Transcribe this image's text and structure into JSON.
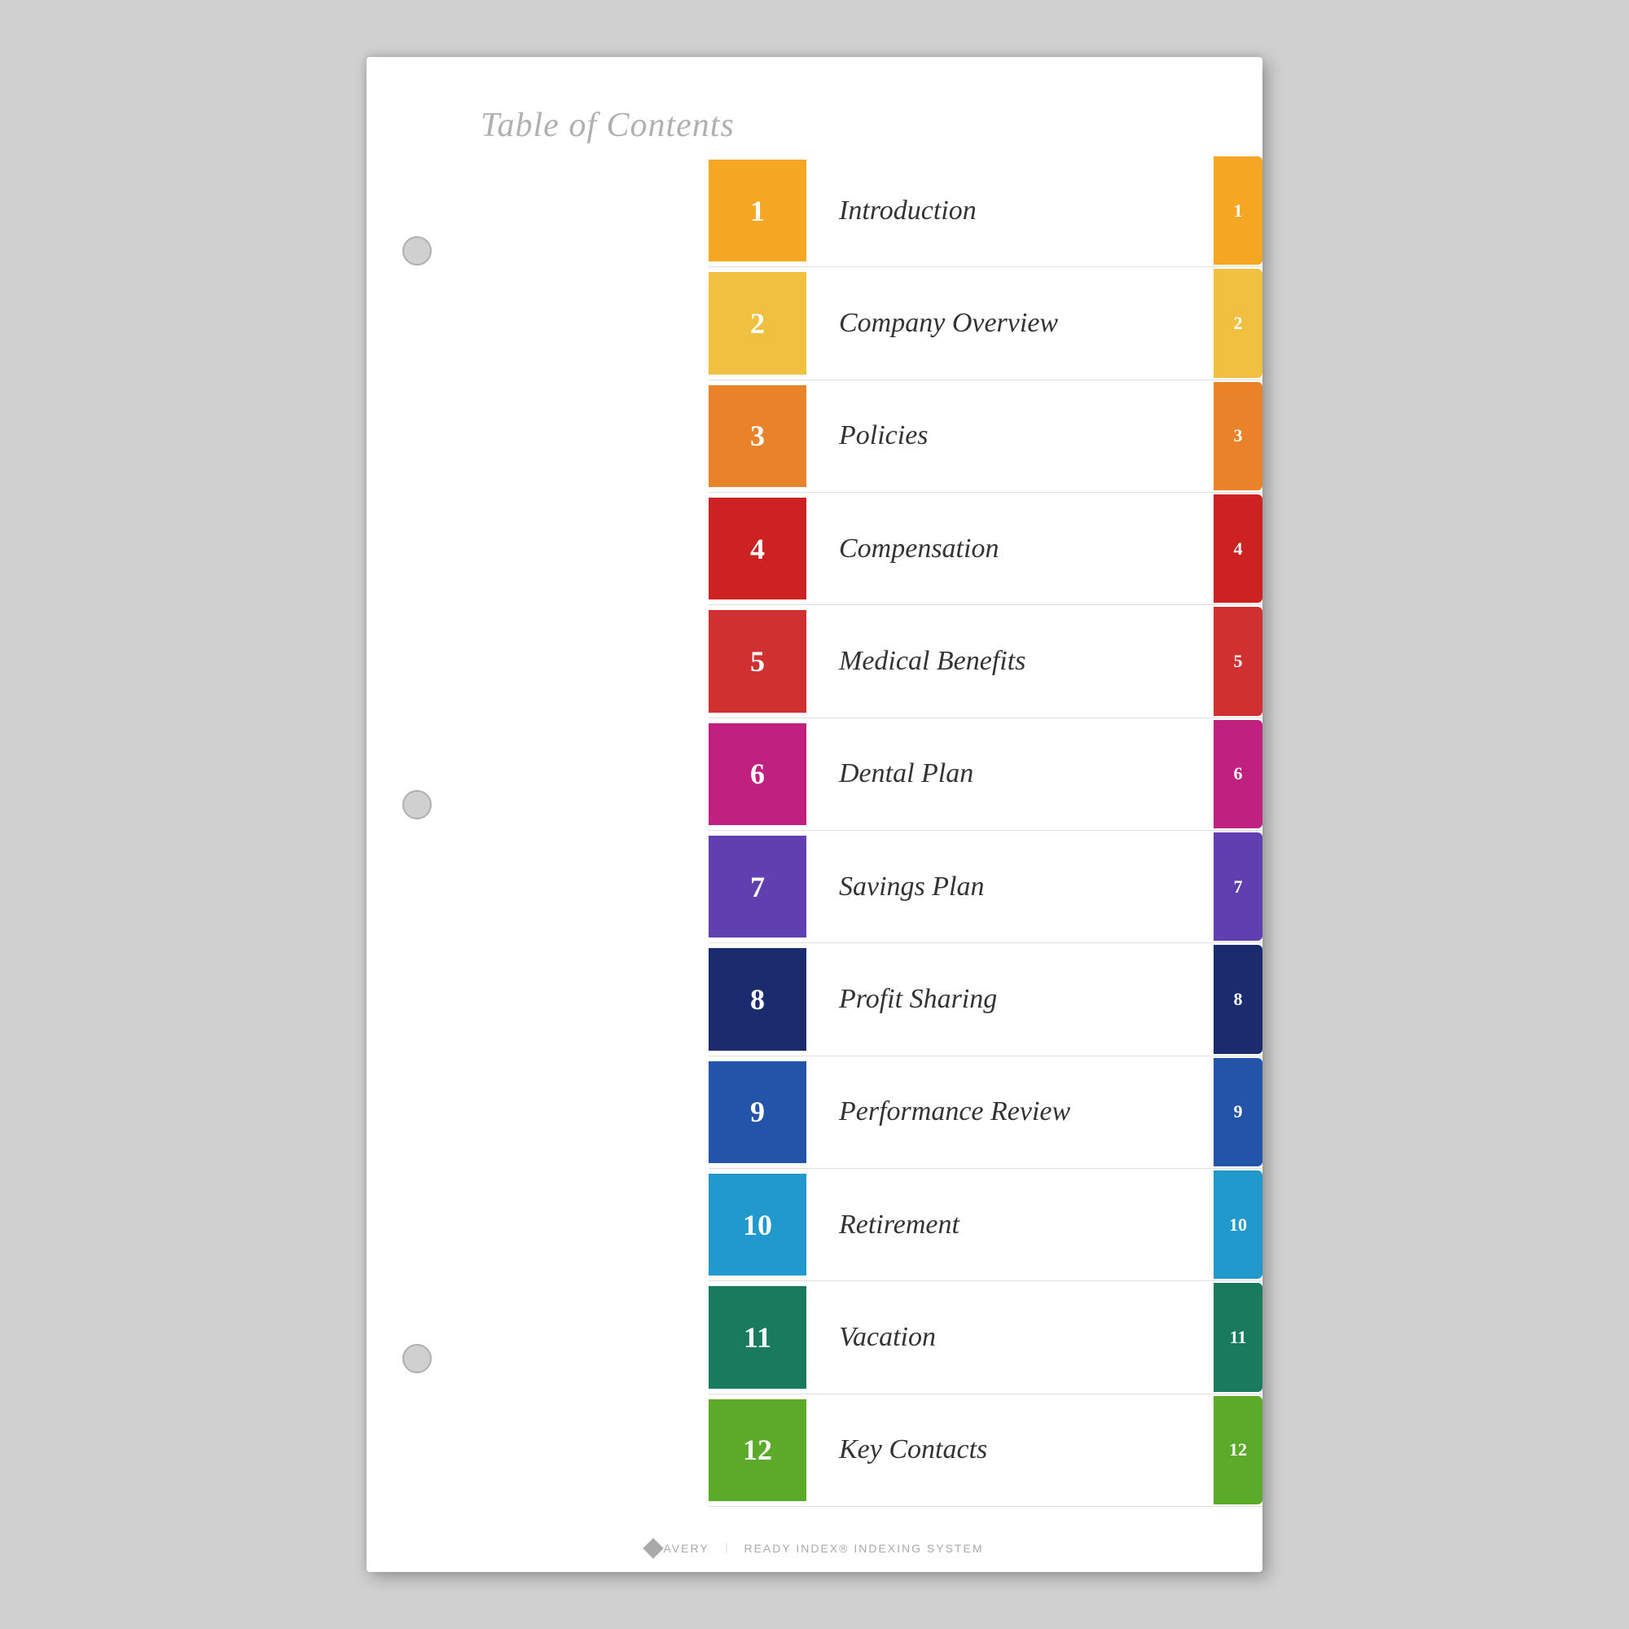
{
  "title": "Table of Contents",
  "footer": {
    "brand": "AVERY",
    "product": "READY INDEX® INDEXING SYSTEM"
  },
  "items": [
    {
      "number": "1",
      "label": "Introduction",
      "numColor": "#F5A623",
      "tabColor": "#F5A623",
      "tabNumber": "1"
    },
    {
      "number": "2",
      "label": "Company Overview",
      "numColor": "#F0C040",
      "tabColor": "#F0C040",
      "tabNumber": "2"
    },
    {
      "number": "3",
      "label": "Policies",
      "numColor": "#E8832A",
      "tabColor": "#E8832A",
      "tabNumber": "3"
    },
    {
      "number": "4",
      "label": "Compensation",
      "numColor": "#CC2222",
      "tabColor": "#CC2222",
      "tabNumber": "4"
    },
    {
      "number": "5",
      "label": "Medical Benefits",
      "numColor": "#D03030",
      "tabColor": "#D03030",
      "tabNumber": "5"
    },
    {
      "number": "6",
      "label": "Dental Plan",
      "numColor": "#C02080",
      "tabColor": "#C02080",
      "tabNumber": "6"
    },
    {
      "number": "7",
      "label": "Savings Plan",
      "numColor": "#6040B0",
      "tabColor": "#6040B0",
      "tabNumber": "7"
    },
    {
      "number": "8",
      "label": "Profit Sharing",
      "numColor": "#1A2C6E",
      "tabColor": "#1A2C6E",
      "tabNumber": "8"
    },
    {
      "number": "9",
      "label": "Performance Review",
      "numColor": "#2255AA",
      "tabColor": "#2255AA",
      "tabNumber": "9"
    },
    {
      "number": "10",
      "label": "Retirement",
      "numColor": "#2299CC",
      "tabColor": "#2299CC",
      "tabNumber": "10"
    },
    {
      "number": "11",
      "label": "Vacation",
      "numColor": "#1A7A5E",
      "tabColor": "#1A7A5E",
      "tabNumber": "11"
    },
    {
      "number": "12",
      "label": "Key Contacts",
      "numColor": "#5BAA2A",
      "tabColor": "#5BAA2A",
      "tabNumber": "12"
    }
  ]
}
